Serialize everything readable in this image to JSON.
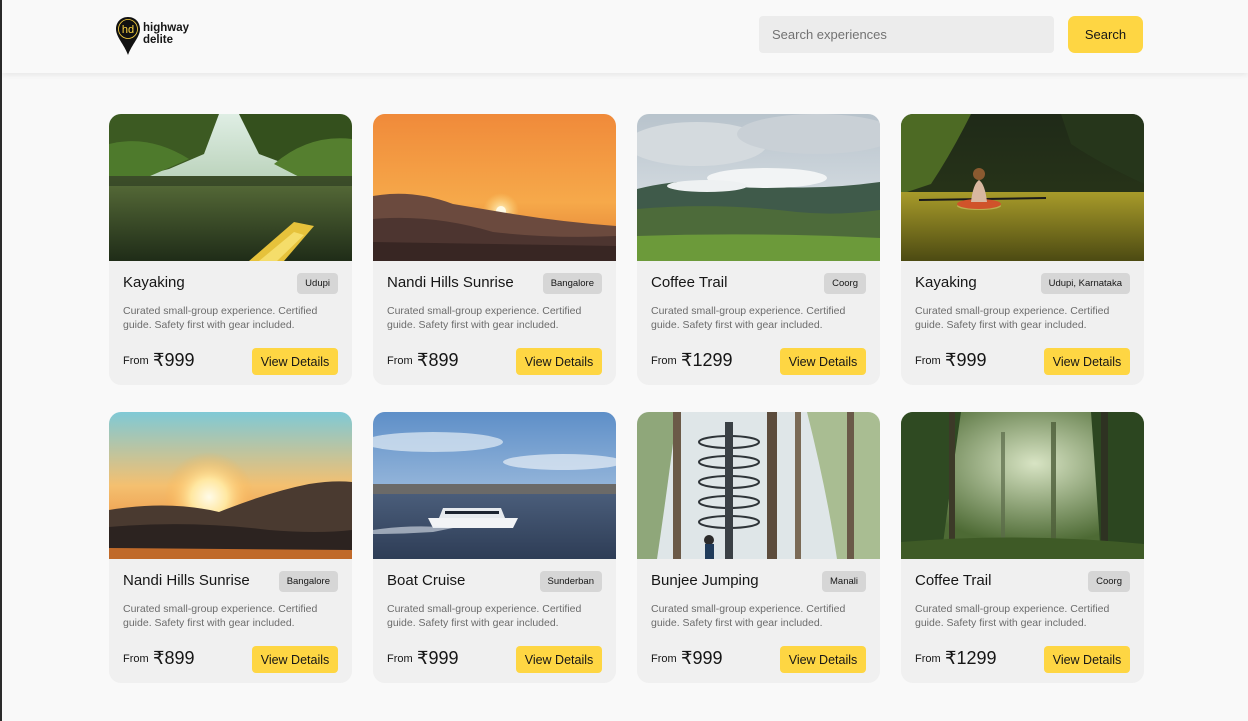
{
  "header": {
    "logo_mark": "hd",
    "logo_line1": "highway",
    "logo_line2": "delite",
    "search_placeholder": "Search experiences",
    "search_label": "Search"
  },
  "colors": {
    "accent": "#fed643",
    "card_bg": "#f0f0f0",
    "badge_bg": "#d6d6d6"
  },
  "cards": [
    {
      "title": "Kayaking",
      "location": "Udupi",
      "description": "Curated small-group experience. Certified guide. Safety first with gear included.",
      "from_label": "From",
      "price": "₹999",
      "button": "View Details",
      "image": "mangrove-kayak"
    },
    {
      "title": "Nandi Hills Sunrise",
      "location": "Bangalore",
      "description": "Curated small-group experience. Certified guide. Safety first with gear included.",
      "from_label": "From",
      "price": "₹899",
      "button": "View Details",
      "image": "orange-sunset-hills"
    },
    {
      "title": "Coffee Trail",
      "location": "Coorg",
      "description": "Curated small-group experience. Certified guide. Safety first with gear included.",
      "from_label": "From",
      "price": "₹1299",
      "button": "View Details",
      "image": "misty-green-valley"
    },
    {
      "title": "Kayaking",
      "location": "Udupi, Karnataka",
      "description": "Curated small-group experience. Certified guide. Safety first with gear included.",
      "from_label": "From",
      "price": "₹999",
      "button": "View Details",
      "image": "river-kayaker"
    },
    {
      "title": "Nandi Hills Sunrise",
      "location": "Bangalore",
      "description": "Curated small-group experience. Certified guide. Safety first with gear included.",
      "from_label": "From",
      "price": "₹899",
      "button": "View Details",
      "image": "sunrise-mountains"
    },
    {
      "title": "Boat Cruise",
      "location": "Sunderban",
      "description": "Curated small-group experience. Certified guide. Safety first with gear included.",
      "from_label": "From",
      "price": "₹999",
      "button": "View Details",
      "image": "ferry-on-water"
    },
    {
      "title": "Bunjee Jumping",
      "location": "Manali",
      "description": "Curated small-group experience. Certified guide. Safety first with gear included.",
      "from_label": "From",
      "price": "₹999",
      "button": "View Details",
      "image": "forest-spiral-tower"
    },
    {
      "title": "Coffee Trail",
      "location": "Coorg",
      "description": "Curated small-group experience. Certified guide. Safety first with gear included.",
      "from_label": "From",
      "price": "₹1299",
      "button": "View Details",
      "image": "misty-forest"
    }
  ]
}
